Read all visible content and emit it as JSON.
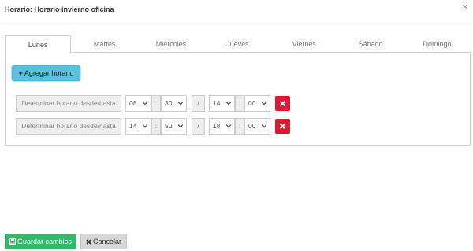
{
  "modal": {
    "title": "Horario: Horario invierno oficina",
    "close_icon": "×"
  },
  "tabs": [
    {
      "label": "Lunes",
      "active": true
    },
    {
      "label": "Martes",
      "active": false
    },
    {
      "label": "Miércoles",
      "active": false
    },
    {
      "label": "Jueves",
      "active": false
    },
    {
      "label": "Viernes",
      "active": false
    },
    {
      "label": "Sábado",
      "active": false
    },
    {
      "label": "Domingo",
      "active": false
    }
  ],
  "add_button": {
    "plus": "+",
    "label": "Agregar horario"
  },
  "rows": [
    {
      "placeholder": "Determinar horario desde/hasta",
      "from_hour": "08",
      "from_min": "30",
      "to_hour": "14",
      "to_min": "00"
    },
    {
      "placeholder": "Determinar horario desde/hasta",
      "from_hour": "14",
      "from_min": "50",
      "to_hour": "18",
      "to_min": "00"
    }
  ],
  "separators": {
    "colon": ":",
    "slash": "/"
  },
  "footer": {
    "save_label": "Guardar cambios",
    "cancel_label": "Cancelar"
  },
  "colors": {
    "accent_info": "#5bc0de",
    "danger": "#e2172f",
    "success": "#3cb56b",
    "neutral": "#d7d7d7"
  }
}
